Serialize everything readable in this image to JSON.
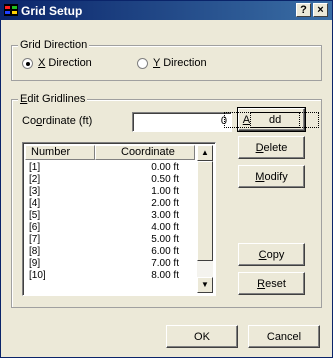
{
  "window": {
    "title": "Grid Setup",
    "help_glyph": "?",
    "close_glyph": "×"
  },
  "direction": {
    "label": "Grid Direction",
    "x_option": {
      "prefix": "",
      "accel": "X",
      "rest": " Direction",
      "checked": true
    },
    "y_option": {
      "prefix": "",
      "accel": "Y",
      "rest": " Direction",
      "checked": false
    }
  },
  "gridlines": {
    "label_accel": "E",
    "label_rest": "dit Gridlines",
    "coordinate_label_pre": "Co",
    "coordinate_label_accel": "o",
    "coordinate_label_rest": "rdinate (ft)",
    "coordinate_value": "0",
    "columns": [
      "Number",
      "Coordinate"
    ],
    "rows": [
      {
        "number": "[1]",
        "coordinate": "0.00 ft"
      },
      {
        "number": "[2]",
        "coordinate": "0.50 ft"
      },
      {
        "number": "[3]",
        "coordinate": "1.00 ft"
      },
      {
        "number": "[4]",
        "coordinate": "2.00 ft"
      },
      {
        "number": "[5]",
        "coordinate": "3.00 ft"
      },
      {
        "number": "[6]",
        "coordinate": "4.00 ft"
      },
      {
        "number": "[7]",
        "coordinate": "5.00 ft"
      },
      {
        "number": "[8]",
        "coordinate": "6.00 ft"
      },
      {
        "number": "[9]",
        "coordinate": "7.00 ft"
      },
      {
        "number": "[10]",
        "coordinate": "8.00 ft"
      }
    ],
    "scroll_up_glyph": "▲",
    "scroll_down_glyph": "▼"
  },
  "buttons": {
    "add": {
      "accel": "A",
      "rest": "dd"
    },
    "delete": {
      "accel": "D",
      "rest": "elete"
    },
    "modify": {
      "accel": "M",
      "rest": "odify"
    },
    "copy": {
      "accel": "C",
      "rest": "opy"
    },
    "reset": {
      "accel": "R",
      "rest": "eset"
    },
    "ok": "OK",
    "cancel": "Cancel"
  },
  "colors": {
    "titlebar_start": "#0a246a",
    "titlebar_end": "#3a6ea5",
    "dialog_bg": "#ece9d8"
  }
}
